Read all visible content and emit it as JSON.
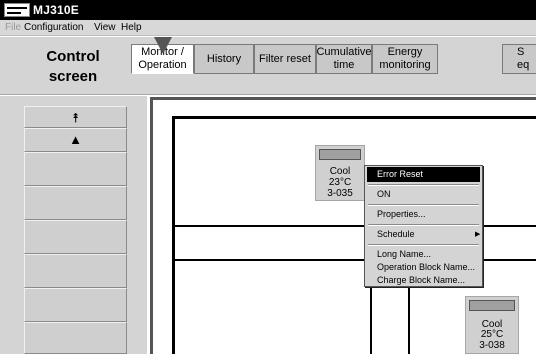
{
  "window": {
    "title": "MJ310E"
  },
  "menu": [
    {
      "label": "File",
      "disabled": true
    },
    {
      "label": "Configuration",
      "disabled": false
    },
    {
      "label": "View",
      "disabled": false
    },
    {
      "label": "Help",
      "disabled": false
    }
  ],
  "header": {
    "control_screen_line1": "Control",
    "control_screen_line2": "screen",
    "tabs": [
      {
        "line1": "Monitor /",
        "line2": "Operation"
      },
      {
        "line1": "History",
        "line2": ""
      },
      {
        "line1": "Filter reset",
        "line2": ""
      },
      {
        "line1": "Cumulative",
        "line2": "time"
      },
      {
        "line1": "Energy",
        "line2": "monitoring"
      },
      {
        "line1": "S",
        "line2": "eq"
      }
    ]
  },
  "side_panel": {
    "buttons": [
      {
        "icon": "double-up-arrow-icon",
        "glyph": "⯭"
      },
      {
        "icon": "up-arrow-icon",
        "glyph": "▲"
      }
    ]
  },
  "units": [
    {
      "mode": "Cool",
      "temp": "23°C",
      "id": "3-035"
    },
    {
      "mode": "Cool",
      "temp": "25°C",
      "id": "3-038"
    }
  ],
  "context_menu": {
    "items": [
      {
        "label": "Error Reset",
        "selected": true
      },
      {
        "label": "ON"
      },
      {
        "label": "Properties..."
      },
      {
        "label": "Schedule",
        "submenu": true,
        "arrow_glyph": "▶"
      },
      {
        "label": "Long Name..."
      },
      {
        "label": "Operation Block Name..."
      },
      {
        "label": "Charge Block Name..."
      }
    ]
  },
  "colors": {
    "titlebar": "#000000",
    "panel": "#d4d4d4",
    "selection": "#000000"
  }
}
